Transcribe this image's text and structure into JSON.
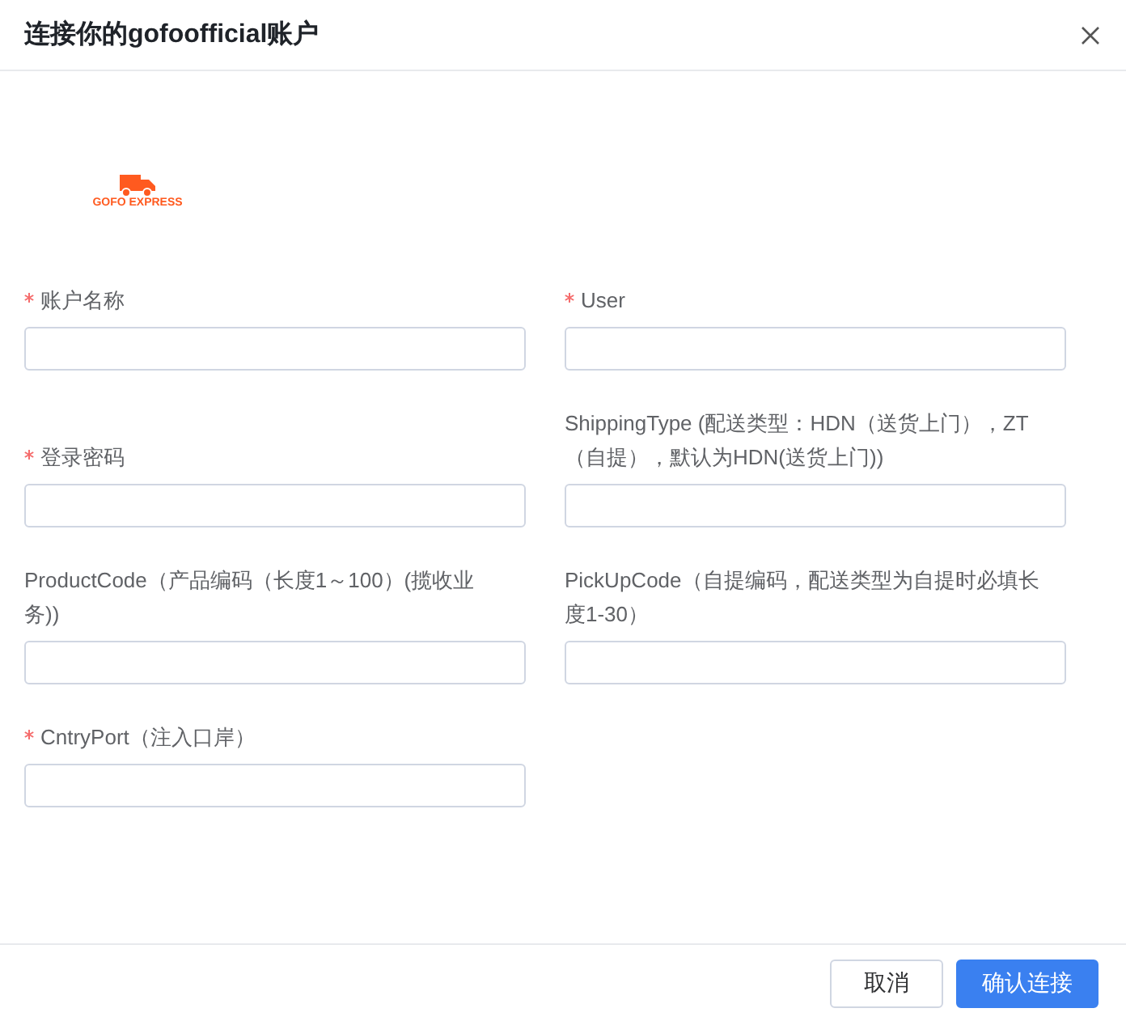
{
  "dialog": {
    "title": "连接你的gofoofficial账户"
  },
  "logo": {
    "text": "GOFO EXPRESS"
  },
  "fields": [
    {
      "label": "账户名称",
      "required": true
    },
    {
      "label": "User",
      "required": true
    },
    {
      "label": "登录密码",
      "required": true
    },
    {
      "label": "ShippingType (配送类型：HDN（送货上门），ZT（自提），默认为HDN(送货上门))",
      "required": false
    },
    {
      "label": "ProductCode（产品编码（长度1～100）(揽收业务))",
      "required": false
    },
    {
      "label": "PickUpCode（自提编码，配送类型为自提时必填长度1-30）",
      "required": false
    },
    {
      "label": "CntryPort（注入口岸）",
      "required": true
    }
  ],
  "buttons": [
    {
      "label": "取消",
      "kind": "secondary"
    },
    {
      "label": "确认连接",
      "kind": "primary"
    }
  ]
}
